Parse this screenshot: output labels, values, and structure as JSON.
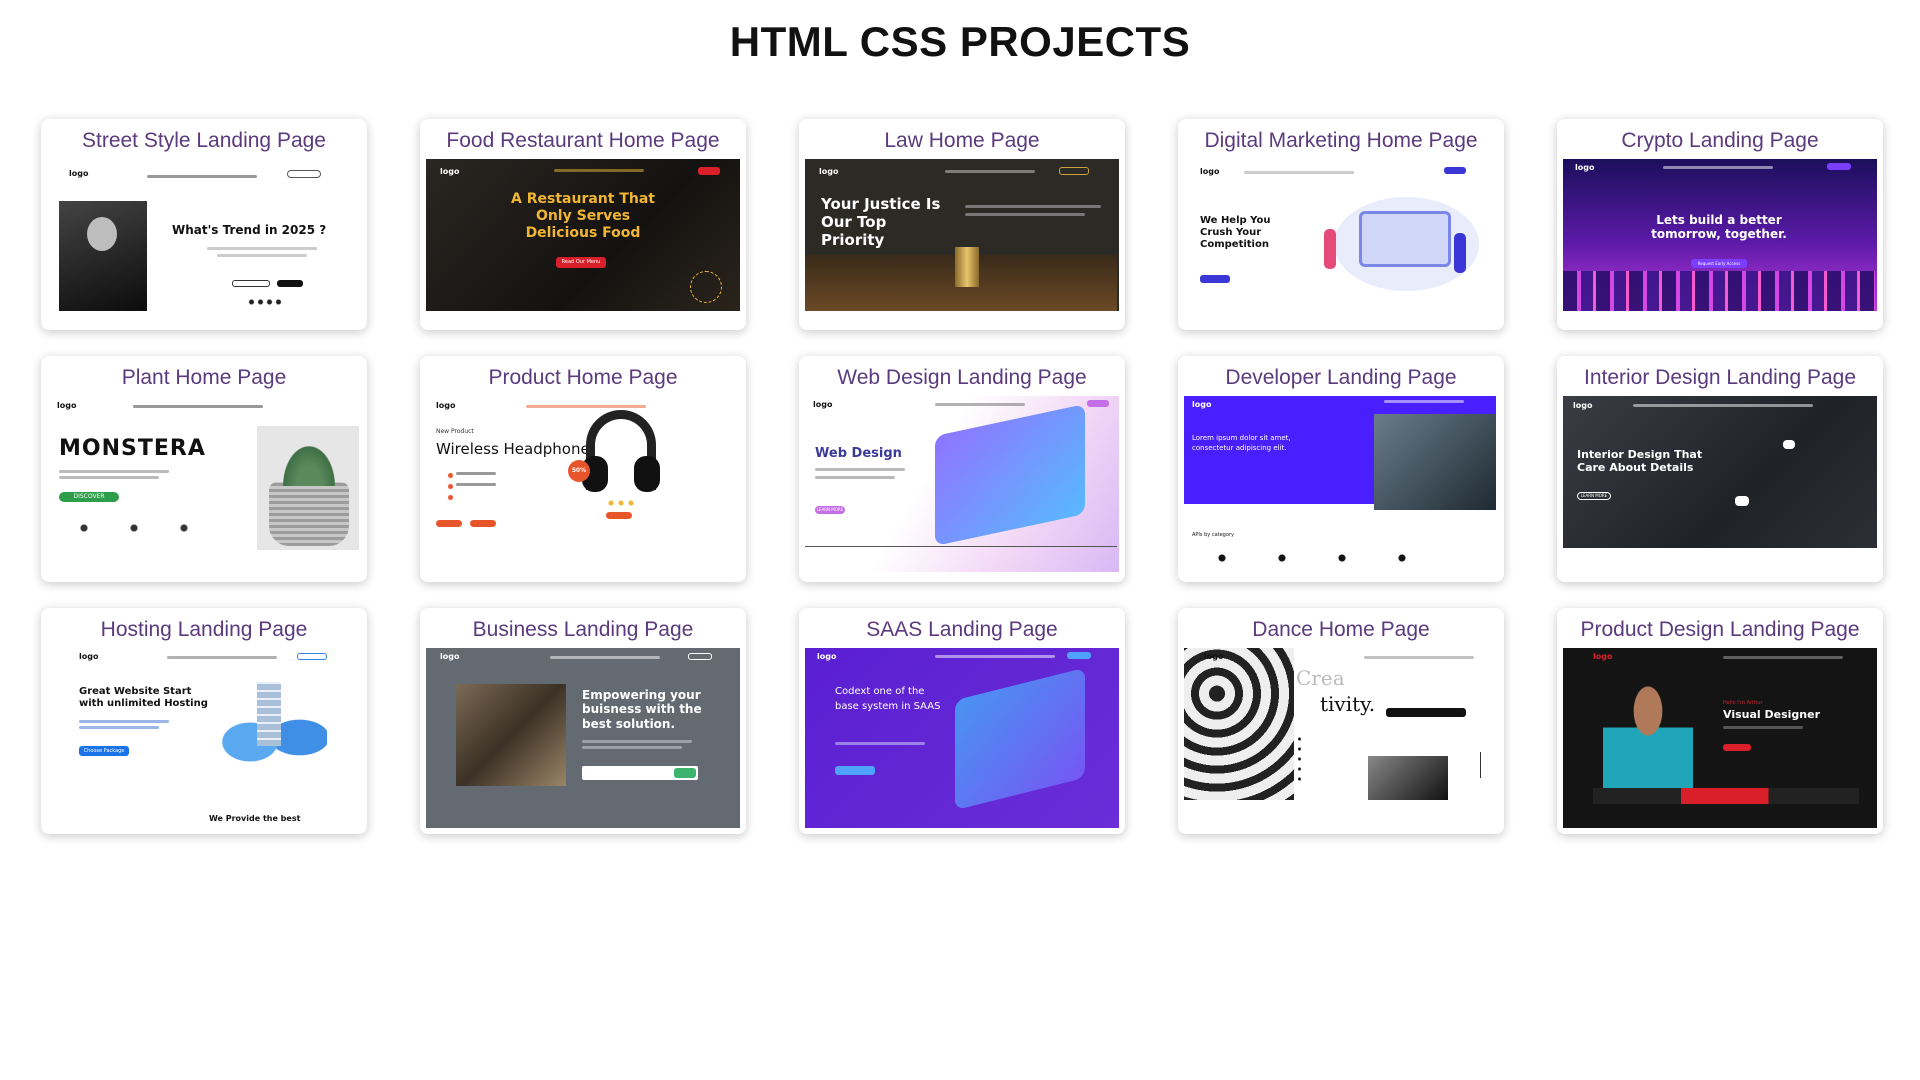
{
  "page": {
    "title": "HTML CSS PROJECTS"
  },
  "cards": [
    {
      "title": "Street Style Landing Page",
      "thumb": {
        "logo": "logo",
        "headline": "What's Trend in 2025 ?"
      }
    },
    {
      "title": "Food Restaurant Home Page",
      "thumb": {
        "logo": "logo",
        "headline": "A Restaurant That Only Serves Delicious Food",
        "button": "Read Our Menu"
      }
    },
    {
      "title": "Law Home Page",
      "thumb": {
        "logo": "logo",
        "headline": "Your Justice Is Our Top Priority"
      }
    },
    {
      "title": "Digital Marketing Home Page",
      "thumb": {
        "logo": "logo",
        "headline": "We Help You Crush Your Competition"
      }
    },
    {
      "title": "Crypto Landing Page",
      "thumb": {
        "logo": "logo",
        "headline": "Lets build a better tomorrow, together.",
        "button": "Request Early Access"
      }
    },
    {
      "title": "Plant Home Page",
      "thumb": {
        "logo": "logo",
        "headline": "MONSTERA",
        "button": "DISCOVER"
      }
    },
    {
      "title": "Product Home Page",
      "thumb": {
        "logo": "logo",
        "eyebrow": "New Product",
        "headline": "Wireless Headphone",
        "badge": "50%"
      }
    },
    {
      "title": "Web Design Landing Page",
      "thumb": {
        "logo": "logo",
        "headline": "Web Design",
        "button": "LEARN MORE"
      }
    },
    {
      "title": "Developer Landing Page",
      "thumb": {
        "logo": "logo",
        "headline": "Lorem ipsum dolor sit amet, consectetur adipiscing elit.",
        "sub": "APIs by category"
      }
    },
    {
      "title": "Interior Design Landing Page",
      "thumb": {
        "logo": "logo",
        "headline": "Interior Design That Care About Details",
        "button": "LEARN MORE"
      }
    },
    {
      "title": "Hosting Landing Page",
      "thumb": {
        "logo": "logo",
        "headline": "Great Website Start with unlimited Hosting",
        "button": "Choose Package",
        "footer": "We Provide the best"
      }
    },
    {
      "title": "Business Landing Page",
      "thumb": {
        "logo": "logo",
        "headline": "Empowering your buisness with the best solution."
      }
    },
    {
      "title": "SAAS Landing Page",
      "thumb": {
        "logo": "logo",
        "headline": "Codext one of the base system in SAAS"
      }
    },
    {
      "title": "Dance Home Page",
      "thumb": {
        "logo": "logo",
        "headline_a": "Crea",
        "headline_b": "tivity."
      }
    },
    {
      "title": "Product Design Landing Page",
      "thumb": {
        "logo": "logo",
        "eyebrow": "Hello I'm Arthur",
        "headline": "Visual Designer"
      }
    }
  ],
  "colors": {
    "title": "#111111",
    "card_title": "#5b3a7e",
    "accent_orange": "#e8552b",
    "accent_red": "#d81f2a",
    "accent_purple": "#4a1fff",
    "accent_gold": "#f2b632"
  }
}
